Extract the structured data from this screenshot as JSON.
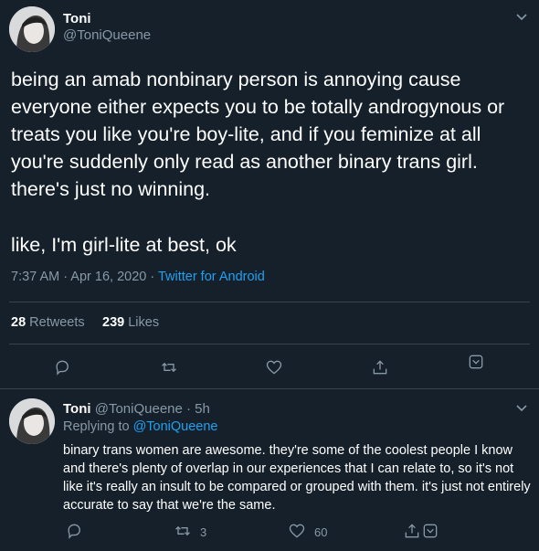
{
  "main_tweet": {
    "author_name": "Toni",
    "author_handle": "@ToniQueene",
    "text_p1": "being an amab nonbinary person is annoying cause everyone either expects you to be totally androgynous or treats you like you're boy-lite, and if you feminize at all you're suddenly only read as another binary trans girl. there's just no winning.",
    "text_p2": "like, I'm girl-lite at best, ok",
    "time": "7:37 AM · Apr 16, 2020 · ",
    "source": "Twitter for Android",
    "retweets_count": "28",
    "retweets_label": "Retweets",
    "likes_count": "239",
    "likes_label": "Likes"
  },
  "reply": {
    "author_name": "Toni",
    "author_meta": "@ToniQueene · 5h",
    "replying_label": "Replying to ",
    "replying_handle": "@ToniQueene",
    "text": "binary trans women are awesome. they're some of the coolest people I know and there's plenty of overlap in our experiences that I can relate to, so it's not like it's really an insult to be compared or grouped with them. it's just not entirely accurate to say that we're the same.",
    "retweet_count": "3",
    "like_count": "60"
  },
  "colors": {
    "background": "#15202b",
    "muted": "#8899a6",
    "accent": "#1da1f2",
    "divider": "#38444d"
  }
}
